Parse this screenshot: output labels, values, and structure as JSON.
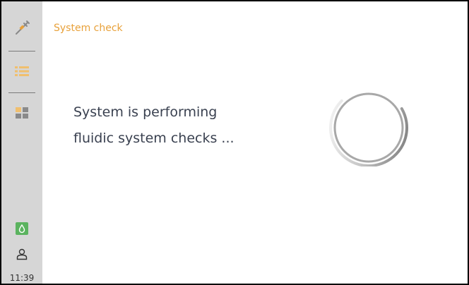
{
  "sidebar": {
    "items": [
      {
        "icon": "syringe-icon"
      },
      {
        "icon": "list-icon"
      },
      {
        "icon": "dashboard-icon"
      }
    ],
    "fluid_icon": "water-drop-icon",
    "user_icon": "user-icon",
    "clock": "11:39"
  },
  "main": {
    "title": "System check",
    "message_line1": "System is performing",
    "message_line2": "fluidic system checks ..."
  },
  "colors": {
    "accent": "#e8a13a",
    "sidebar_bg": "#d6d6d6",
    "text": "#3a4150",
    "status_green": "#5bb35f"
  }
}
